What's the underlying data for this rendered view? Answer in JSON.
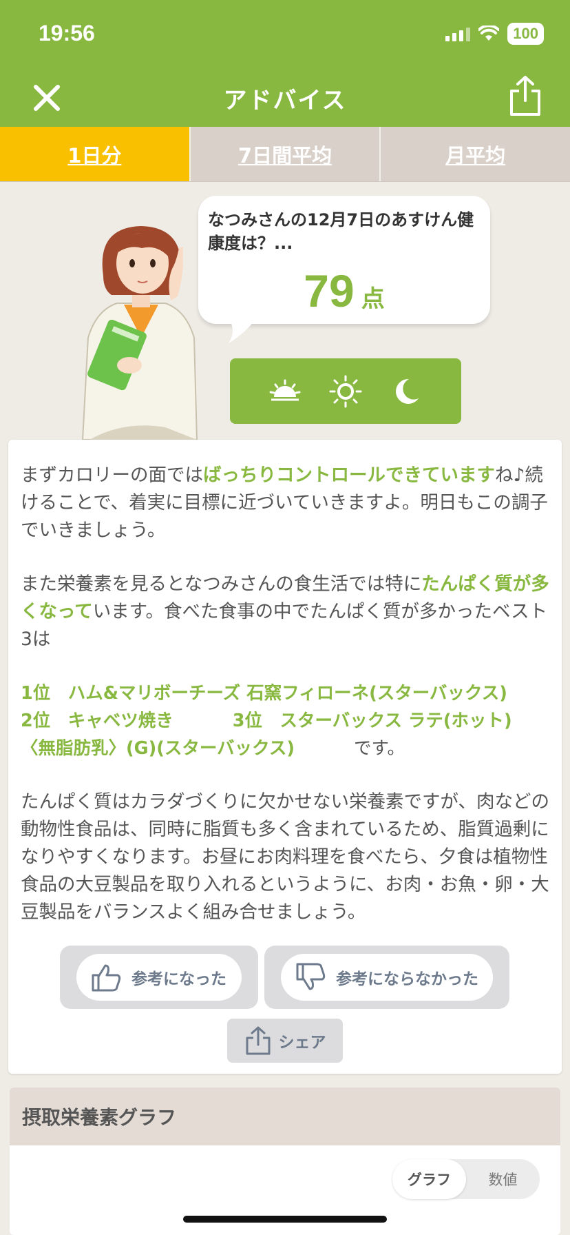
{
  "status": {
    "time": "19:56",
    "battery": "100"
  },
  "header": {
    "title": "アドバイス",
    "close_icon": "close-icon",
    "share_icon": "share-icon"
  },
  "tabs": [
    {
      "label": "1日分",
      "active": true
    },
    {
      "label": "7日間平均",
      "active": false
    },
    {
      "label": "月平均",
      "active": false
    }
  ],
  "bubble": {
    "text": "なつみさんの12月7日のあすけん健康度は？...",
    "score": "79",
    "unit": "点"
  },
  "time_icons": [
    "sunrise-icon",
    "sun-icon",
    "moon-icon"
  ],
  "advice": {
    "p1_a": "まずカロリーの面では",
    "p1_hl": "ばっちりコントロールできています",
    "p1_b": "ね♪続けることで、着実に目標に近づいていきますよ。明日もこの調子でいきましょう。",
    "p2_a": "また栄養素を見るとなつみさんの食生活では特に",
    "p2_hl": "たんぱく質が多くなって",
    "p2_b": "います。食べた食事の中でたんぱく質が多かったベスト3は",
    "rank1": "1位　ハム&マリボーチーズ 石窯フィローネ(スターバックス)",
    "rank2": "2位　キャベツ焼き",
    "rank3a": "3位　スターバックス ラテ(ホット)",
    "rank3b": "〈無脂肪乳〉(G)(スターバックス)",
    "rank_end": "です。",
    "p3": "たんぱく質はカラダづくりに欠かせない栄養素ですが、肉などの動物性食品は、同時に脂質も多く含まれているため、脂質過剰になりやすくなります。お昼にお肉料理を食べたら、夕食は植物性食品の大豆製品を取り入れるというように、お肉・お魚・卵・大豆製品をバランスよく組み合せましょう。"
  },
  "feedback": {
    "good": "参考になった",
    "bad": "参考にならなかった",
    "share": "シェア"
  },
  "graph": {
    "title": "摂取栄養素グラフ",
    "opt_graph": "グラフ",
    "opt_value": "数値"
  },
  "colors": {
    "brand_green": "#88b840",
    "tab_active": "#f9c000",
    "tab_inactive": "#d9d0c9"
  }
}
